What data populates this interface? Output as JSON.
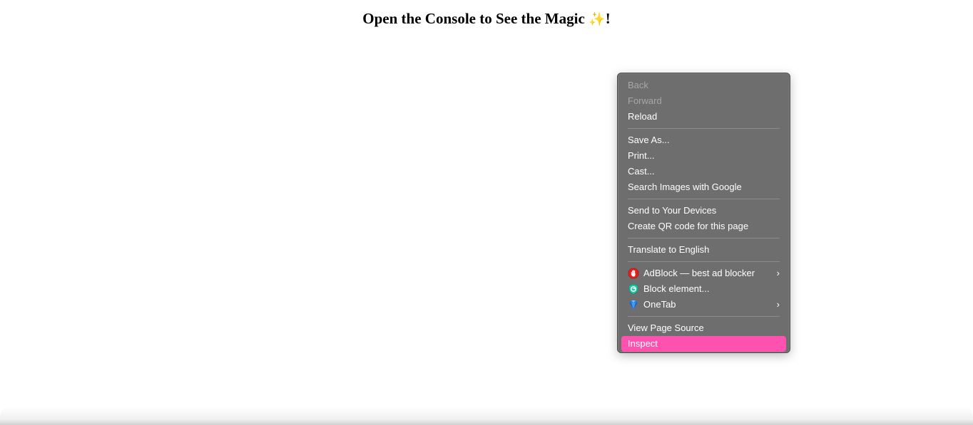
{
  "page": {
    "heading_text": "Open the Console to See the Magic ",
    "heading_emoji": "✨",
    "heading_suffix": "!"
  },
  "context_menu": {
    "groups": [
      {
        "items": [
          {
            "label": "Back",
            "enabled": false
          },
          {
            "label": "Forward",
            "enabled": false
          },
          {
            "label": "Reload",
            "enabled": true
          }
        ]
      },
      {
        "items": [
          {
            "label": "Save As...",
            "enabled": true
          },
          {
            "label": "Print...",
            "enabled": true
          },
          {
            "label": "Cast...",
            "enabled": true
          },
          {
            "label": "Search Images with Google",
            "enabled": true
          }
        ]
      },
      {
        "items": [
          {
            "label": "Send to Your Devices",
            "enabled": true
          },
          {
            "label": "Create QR code for this page",
            "enabled": true
          }
        ]
      },
      {
        "items": [
          {
            "label": "Translate to English",
            "enabled": true
          }
        ]
      },
      {
        "items": [
          {
            "label": "AdBlock — best ad blocker",
            "icon": "adblock-hand-icon",
            "submenu": true
          },
          {
            "label": "Block element...",
            "icon": "block-element-icon",
            "submenu": false
          },
          {
            "label": "OneTab",
            "icon": "onetab-icon",
            "submenu": true
          }
        ]
      },
      {
        "items": [
          {
            "label": "View Page Source",
            "enabled": true
          },
          {
            "label": "Inspect",
            "enabled": true,
            "selected": true
          }
        ]
      }
    ],
    "colors": {
      "background": "#6e6e6e",
      "highlight": "#ff52ae",
      "disabled_text": "#a7a7a7"
    }
  }
}
